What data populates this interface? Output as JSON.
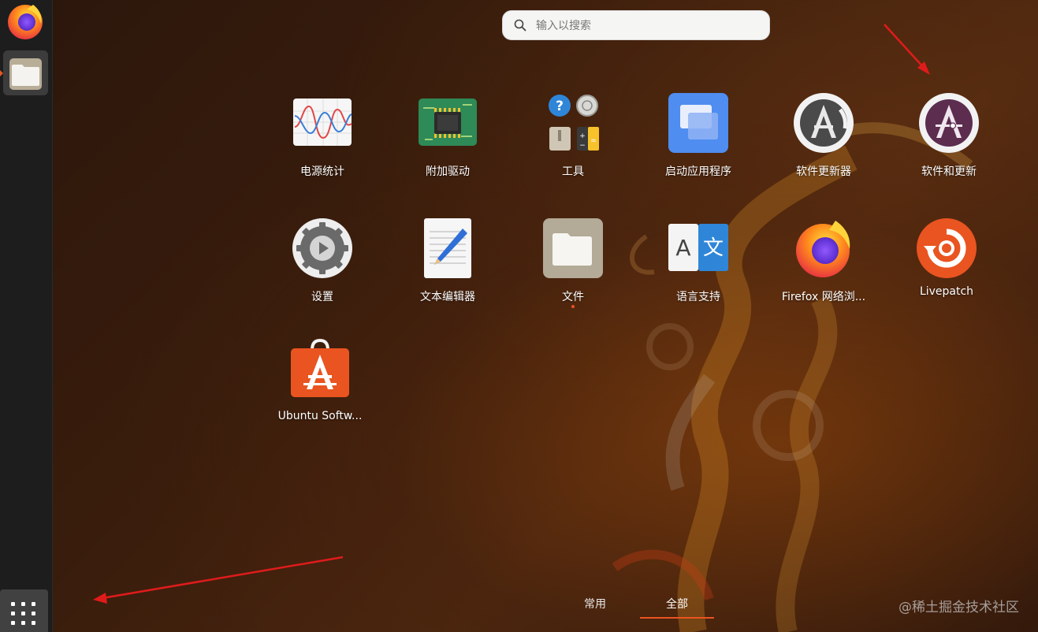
{
  "search": {
    "placeholder": "输入以搜索",
    "icon": "search-icon"
  },
  "dock": {
    "items": [
      {
        "name": "Firefox",
        "icon": "firefox-icon"
      },
      {
        "name": "文件",
        "icon": "files-icon",
        "running": true
      },
      {
        "name": "显示应用程序",
        "icon": "app-grid-icon"
      }
    ]
  },
  "apps": [
    {
      "label": "电源统计",
      "icon": "power-statistics-icon"
    },
    {
      "label": "附加驱动",
      "icon": "additional-drivers-icon"
    },
    {
      "label": "工具",
      "icon": "utilities-folder-icon"
    },
    {
      "label": "启动应用程序",
      "icon": "startup-applications-icon"
    },
    {
      "label": "软件更新器",
      "icon": "software-updater-icon"
    },
    {
      "label": "软件和更新",
      "icon": "software-properties-icon"
    },
    {
      "label": "设置",
      "icon": "settings-gear-icon"
    },
    {
      "label": "文本编辑器",
      "icon": "text-editor-icon"
    },
    {
      "label": "文件",
      "icon": "files-icon",
      "running": true
    },
    {
      "label": "语言支持",
      "icon": "language-support-icon"
    },
    {
      "label": "Firefox 网络浏...",
      "icon": "firefox-icon"
    },
    {
      "label": "Livepatch",
      "icon": "livepatch-icon"
    },
    {
      "label": "Ubuntu Softw...",
      "icon": "ubuntu-software-icon"
    }
  ],
  "tabs": [
    {
      "label": "常用",
      "active": false
    },
    {
      "label": "全部",
      "active": true
    }
  ],
  "watermark": "@稀土掘金技术社区",
  "colors": {
    "accent": "#e95420",
    "annotation_arrow": "#e01b1b"
  }
}
